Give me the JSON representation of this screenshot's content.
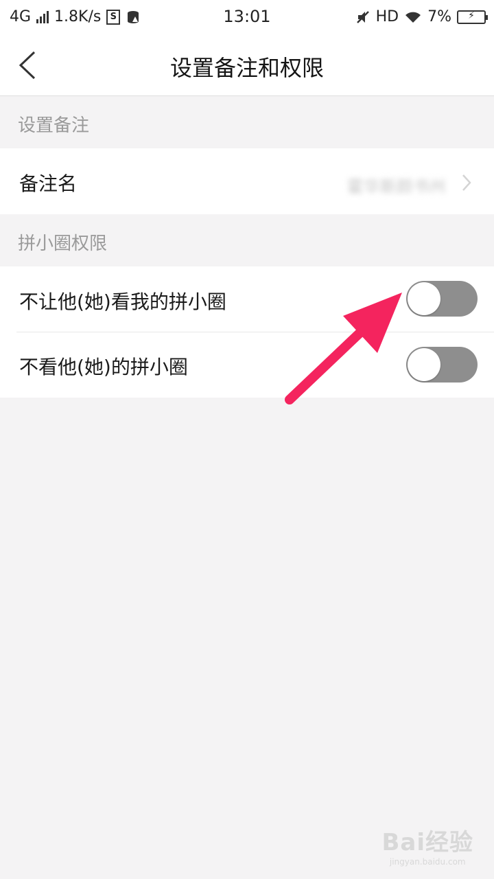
{
  "status_bar": {
    "network": "4G",
    "speed": "1.8K/s",
    "s_icon_label": "S",
    "time": "13:01",
    "hd": "HD",
    "battery": "7%"
  },
  "navbar": {
    "title": "设置备注和权限",
    "back_icon": "chevron-left-icon"
  },
  "sections": {
    "remark": {
      "header": "设置备注",
      "row_label": "备注名",
      "row_value": "霍华斯颜书州"
    },
    "permission": {
      "header": "拼小圈权限",
      "items": [
        {
          "label": "不让他(她)看我的拼小圈",
          "enabled": false
        },
        {
          "label": "不看他(她)的拼小圈",
          "enabled": false
        }
      ]
    }
  },
  "colors": {
    "toggle_off": "#8e8e8e",
    "arrow": "#f4245e",
    "background": "#f4f3f4"
  },
  "watermark": {
    "main": "Bai经验",
    "sub": "jingyan.baidu.com"
  }
}
